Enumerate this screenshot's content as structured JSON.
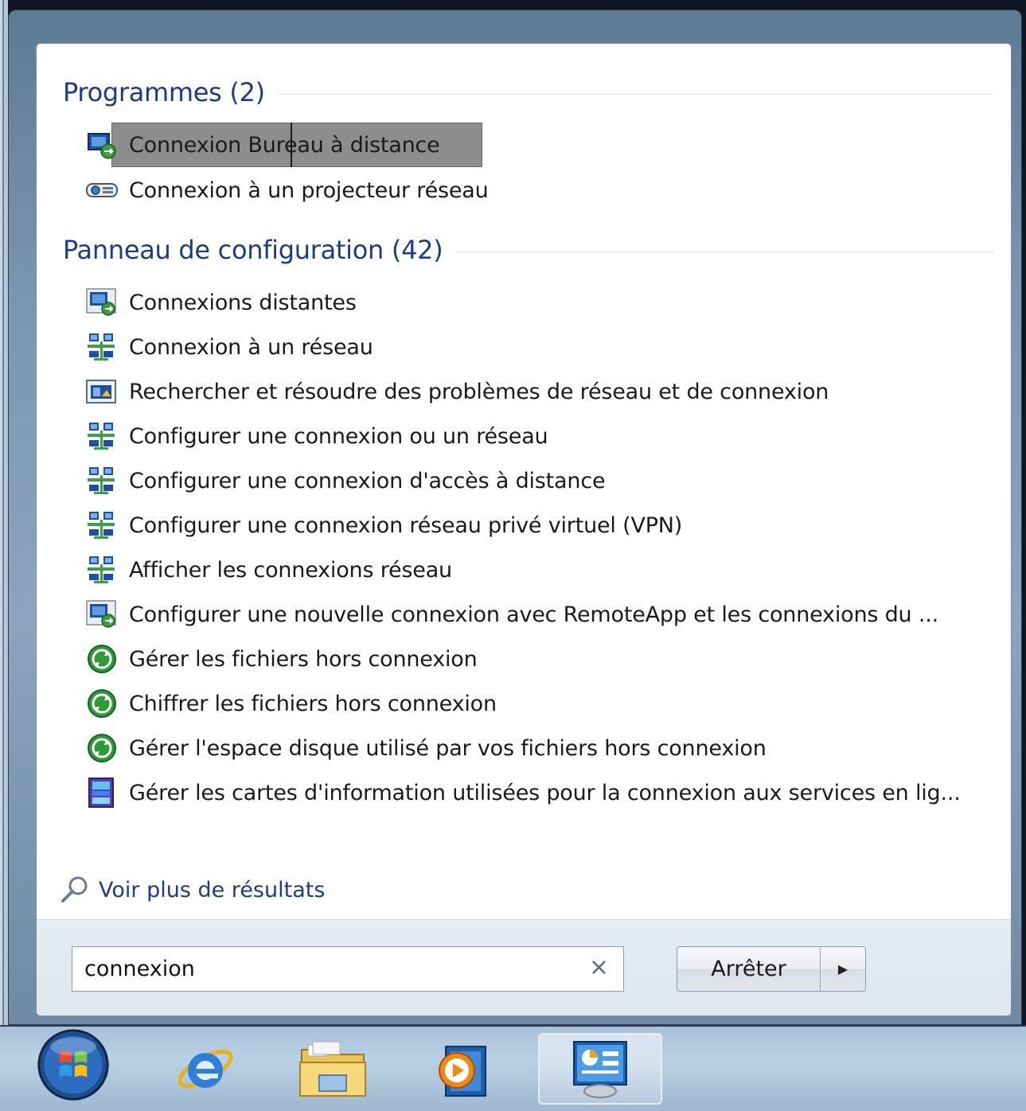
{
  "programs": {
    "title": "Programmes (2)",
    "items": [
      {
        "label": "Connexion Bureau à distance",
        "icon": "remote-desktop-icon"
      },
      {
        "label": "Connexion à un projecteur réseau",
        "icon": "projector-icon"
      }
    ]
  },
  "control_panel": {
    "title": "Panneau de configuration (42)",
    "items": [
      {
        "label": "Connexions distantes",
        "icon": "remote-desktop-icon"
      },
      {
        "label": "Connexion à un réseau",
        "icon": "network-icon"
      },
      {
        "label": "Rechercher et résoudre des problèmes de réseau et de connexion",
        "icon": "troubleshoot-icon"
      },
      {
        "label": "Configurer une connexion ou un réseau",
        "icon": "network-icon"
      },
      {
        "label": "Configurer une connexion d'accès à distance",
        "icon": "network-icon"
      },
      {
        "label": "Configurer une connexion réseau privé virtuel (VPN)",
        "icon": "network-icon"
      },
      {
        "label": "Afficher les connexions réseau",
        "icon": "network-icon"
      },
      {
        "label": "Configurer une nouvelle connexion avec RemoteApp et les connexions du ...",
        "icon": "remote-desktop-icon"
      },
      {
        "label": "Gérer les fichiers hors connexion",
        "icon": "sync-icon"
      },
      {
        "label": "Chiffrer les fichiers hors connexion",
        "icon": "sync-icon"
      },
      {
        "label": "Gérer l'espace disque utilisé par vos fichiers hors connexion",
        "icon": "sync-icon"
      },
      {
        "label": "Gérer les cartes d'information utilisées pour la connexion aux services en lig...",
        "icon": "cardspace-icon"
      }
    ]
  },
  "more_results": "Voir plus de résultats",
  "search": {
    "value": "connexion",
    "clear": "×"
  },
  "shutdown": {
    "label": "Arrêter",
    "arrow": "▶"
  },
  "taskbar": [
    "start-orb-icon",
    "internet-explorer-icon",
    "explorer-icon",
    "media-player-icon",
    "control-panel-icon"
  ],
  "colors": {
    "header_blue": "#1e3a8a",
    "highlight_gray": "#8d8d8d"
  }
}
